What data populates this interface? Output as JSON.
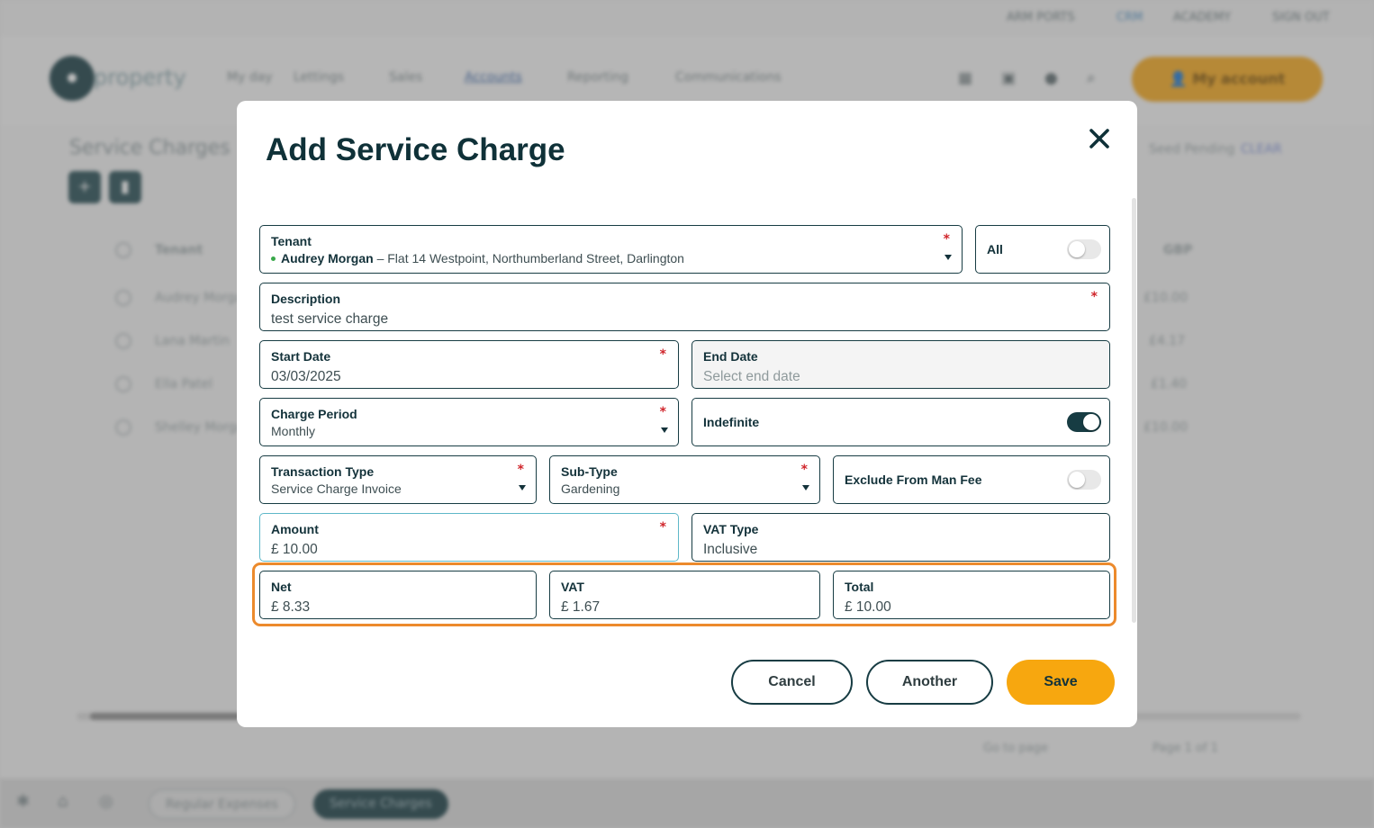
{
  "background": {
    "top_links": [
      "ARM PORTS",
      "CRM",
      "ACADEMY",
      "SIGN OUT"
    ],
    "logo_text": "property",
    "nav_items": [
      "My day",
      "Lettings",
      "Sales",
      "Accounts",
      "Reporting",
      "Communications"
    ],
    "account_button": "My account",
    "page_title": "Service Charges",
    "right_filter_label": "Seed Pending",
    "right_filter_value": "CLEAR",
    "table_header": {
      "tenant": "Tenant",
      "amount": "GBP"
    },
    "rows": [
      {
        "tenant": "Audrey Morgan",
        "amount": "£10.00"
      },
      {
        "tenant": "Lana Martin",
        "amount": "£4.17"
      },
      {
        "tenant": "Ella Patel",
        "amount": "£1.40"
      },
      {
        "tenant": "Shelley Morgan",
        "amount": "£10.00"
      }
    ],
    "pager_text": "Go to page",
    "page_info": "Page 1 of 1",
    "bottom_chips": [
      "Regular Expenses",
      "Service Charges"
    ]
  },
  "modal": {
    "title": "Add Service Charge",
    "tenant": {
      "label": "Tenant",
      "name": "Audrey Morgan",
      "address": " – Flat 14 Westpoint, Northumberland Street, Darlington"
    },
    "all_toggle": {
      "label": "All",
      "on": false
    },
    "description": {
      "label": "Description",
      "value": "test service charge"
    },
    "start_date": {
      "label": "Start Date",
      "value": "03/03/2025"
    },
    "end_date": {
      "label": "End Date",
      "placeholder": "Select end date"
    },
    "charge_period": {
      "label": "Charge Period",
      "value": "Monthly"
    },
    "indefinite": {
      "label": "Indefinite",
      "on": true
    },
    "transaction_type": {
      "label": "Transaction Type",
      "value": "Service Charge Invoice"
    },
    "sub_type": {
      "label": "Sub-Type",
      "value": "Gardening"
    },
    "exclude_man_fee": {
      "label": "Exclude From Man Fee",
      "on": false
    },
    "amount": {
      "label": "Amount",
      "value": "£ 10.00"
    },
    "vat_type": {
      "label": "VAT Type",
      "value": "Inclusive"
    },
    "net": {
      "label": "Net",
      "value": "£ 8.33"
    },
    "vat": {
      "label": "VAT",
      "value": "£ 1.67"
    },
    "total": {
      "label": "Total",
      "value": "£ 10.00"
    },
    "buttons": {
      "cancel": "Cancel",
      "another": "Another",
      "save": "Save"
    },
    "required_mark": "*"
  },
  "colors": {
    "primary_dark": "#173c43",
    "accent_orange": "#f7a70f",
    "highlight_orange": "#ec8a2c",
    "required_red": "#d0262c"
  }
}
